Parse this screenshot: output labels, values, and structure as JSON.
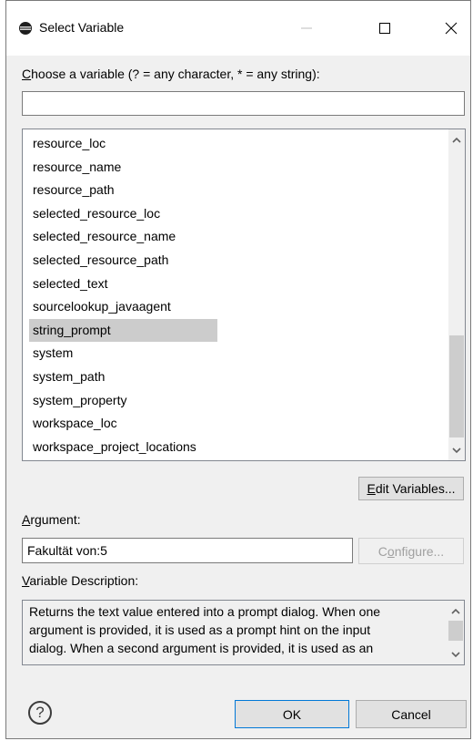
{
  "window": {
    "title": "Select Variable",
    "icon": "eclipse-icon",
    "controls": [
      "minimize-icon",
      "maximize-icon",
      "close-icon"
    ]
  },
  "filter": {
    "label_mnemonic": "C",
    "label_rest": "hoose a variable (? = any character, * = any string):",
    "value": ""
  },
  "variables": {
    "items": [
      "resource_loc",
      "resource_name",
      "resource_path",
      "selected_resource_loc",
      "selected_resource_name",
      "selected_resource_path",
      "selected_text",
      "sourcelookup_javaagent",
      "string_prompt",
      "system",
      "system_path",
      "system_property",
      "workspace_loc",
      "workspace_project_locations"
    ],
    "selected": "string_prompt",
    "scroll_position": 1.0
  },
  "edit_variables": {
    "mnemonic": "E",
    "rest": "dit Variables..."
  },
  "argument": {
    "label_mnemonic": "A",
    "label_rest": "rgument:",
    "value": "Fakultät von:5"
  },
  "configure": {
    "pre": "C",
    "mnemonic": "o",
    "rest": "nfigure...",
    "enabled": false
  },
  "description": {
    "label_mnemonic": "V",
    "label_rest": "ariable Description:",
    "lines": [
      "Returns the text value entered into a prompt dialog. When one",
      "argument is provided, it is used as a prompt hint on the input",
      "dialog. When a second argument is provided, it is used as an"
    ]
  },
  "footer": {
    "help_icon": "help-icon",
    "ok_label": "OK",
    "cancel_label": "Cancel"
  },
  "colors": {
    "selection": "#cccccc",
    "dialog_bg": "#f0f0f0",
    "button_bg": "#e1e1e1"
  }
}
